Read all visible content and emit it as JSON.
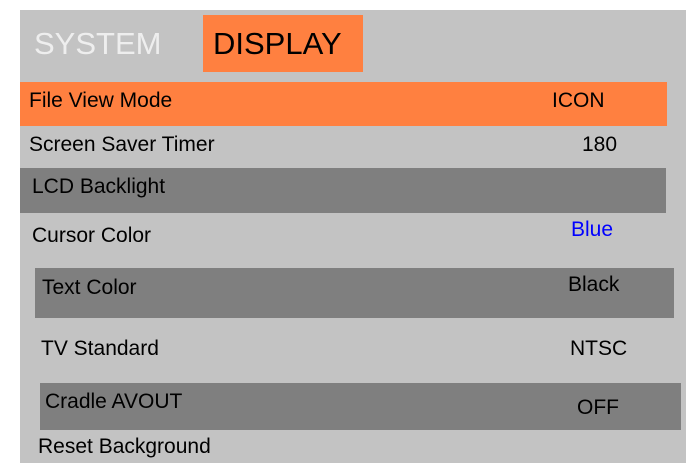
{
  "tabs": {
    "system": "SYSTEM",
    "display": "DISPLAY",
    "active": "DISPLAY"
  },
  "menu": {
    "items": [
      {
        "label": "File View Mode",
        "value": "ICON",
        "state": "selected"
      },
      {
        "label": "Screen Saver Timer",
        "value": "180",
        "state": "normal"
      },
      {
        "label": "LCD Backlight",
        "value": "",
        "state": "shaded"
      },
      {
        "label": "Cursor Color",
        "value": "Blue",
        "state": "normal"
      },
      {
        "label": "Text Color",
        "value": "Black",
        "state": "shaded"
      },
      {
        "label": "TV Standard",
        "value": "NTSC",
        "state": "normal"
      },
      {
        "label": "Cradle AVOUT",
        "value": "OFF",
        "state": "shaded"
      },
      {
        "label": "Reset Background",
        "value": "",
        "state": "normal"
      }
    ]
  },
  "colors": {
    "panel_background": "#c3c3c3",
    "highlight": "#ff8040",
    "shaded_row": "#7f7f7f",
    "inactive_tab_text": "#eeeeee",
    "cursor_color_value": "#0000ff"
  }
}
